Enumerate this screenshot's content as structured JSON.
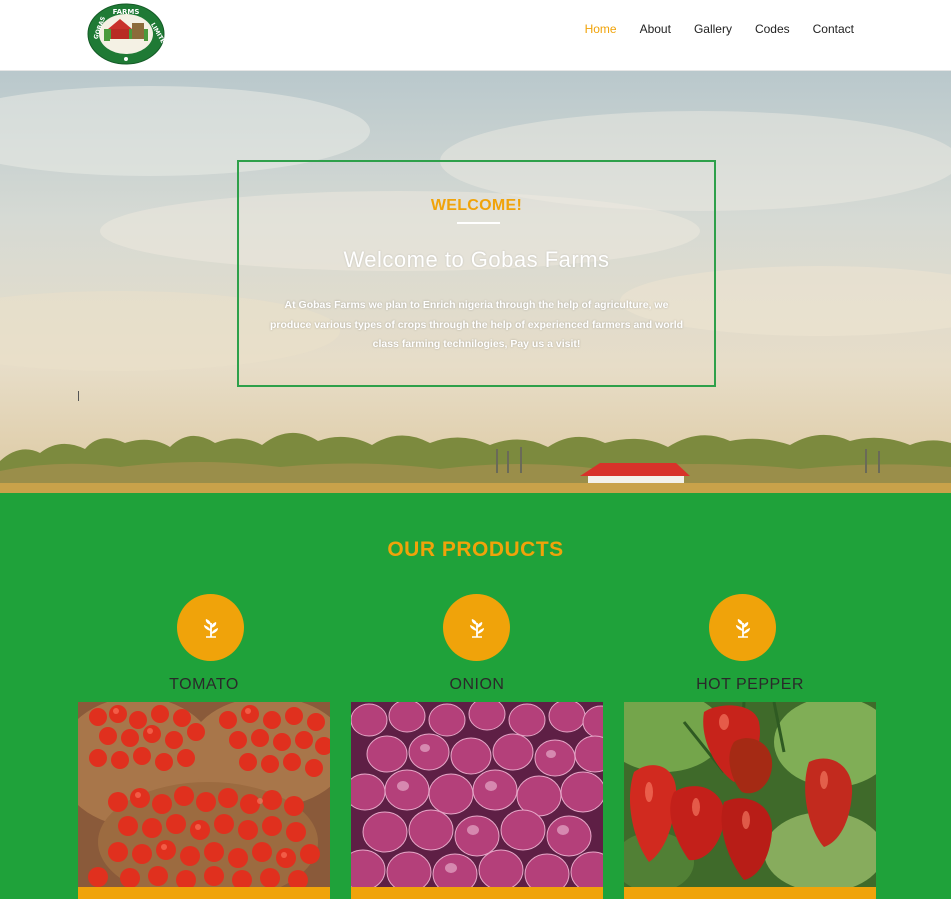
{
  "header": {
    "logo_text_top": "FARMS",
    "logo_text_left": "GOBAS",
    "logo_text_right": "LIMITED",
    "nav": [
      {
        "label": "Home",
        "active": true
      },
      {
        "label": "About",
        "active": false
      },
      {
        "label": "Gallery",
        "active": false
      },
      {
        "label": "Codes",
        "active": false
      },
      {
        "label": "Contact",
        "active": false
      }
    ]
  },
  "hero": {
    "kicker": "WELCOME!",
    "title": "Welcome to Gobas Farms",
    "text": "At Gobas Farms we plan to Enrich nigeria through the help of agriculture, we produce various types of crops through the help of experienced farmers and world class farming technilogies, Pay us a visit!"
  },
  "products": {
    "title": "OUR PRODUCTS",
    "items": [
      {
        "name": "TOMATO",
        "icon": "plant-icon"
      },
      {
        "name": "ONION",
        "icon": "plant-icon"
      },
      {
        "name": "HOT PEPPER",
        "icon": "plant-icon"
      }
    ]
  },
  "colors": {
    "accent": "#f0a30a",
    "green": "#1fa23a",
    "box_border": "#2ea04a"
  }
}
